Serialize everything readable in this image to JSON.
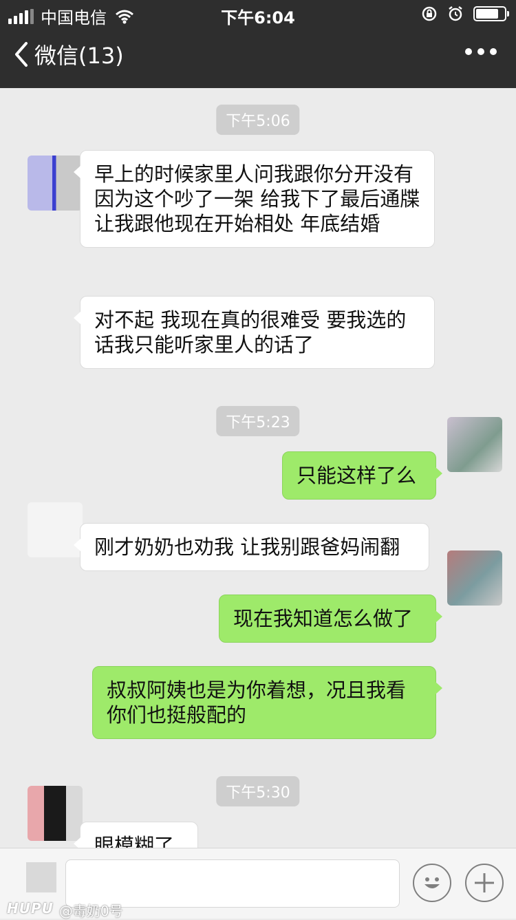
{
  "status_bar": {
    "carrier": "中国电信",
    "time": "下午6:04",
    "battery_level": 0.8
  },
  "nav": {
    "back_label": "微信(13)",
    "back_icon": "chevron-left-icon",
    "more_icon": "more-dots-icon"
  },
  "messages": {
    "ts1": "下午5:06",
    "m1": "早上的时候家里人问我跟你分开没有 因为这个吵了一架 给我下了最后通牒 让我跟他现在开始相处 年底结婚",
    "m2": "对不起 我现在真的很难受 要我选的话我只能听家里人的话了",
    "ts2": "下午5:23",
    "m3": "只能这样了么",
    "m4": "刚才奶奶也劝我 让我别跟爸妈闹翻",
    "m5": "现在我知道怎么做了",
    "m6": "叔叔阿姨也是为你着想，况且我看你们也挺般配的",
    "ts3": "下午5:30",
    "m7": "眼模糊了"
  },
  "input_bar": {
    "placeholder": "",
    "emoji_icon": "emoji-icon",
    "plus_icon": "plus-icon"
  },
  "watermark": {
    "logo": "HUPU",
    "handle": "@毒奶0号"
  },
  "colors": {
    "header_bg": "#2e2e2e",
    "chat_bg": "#ebebeb",
    "outgoing_bubble": "#9eea6a",
    "incoming_bubble": "#ffffff",
    "timestamp_bg": "#cecece"
  }
}
